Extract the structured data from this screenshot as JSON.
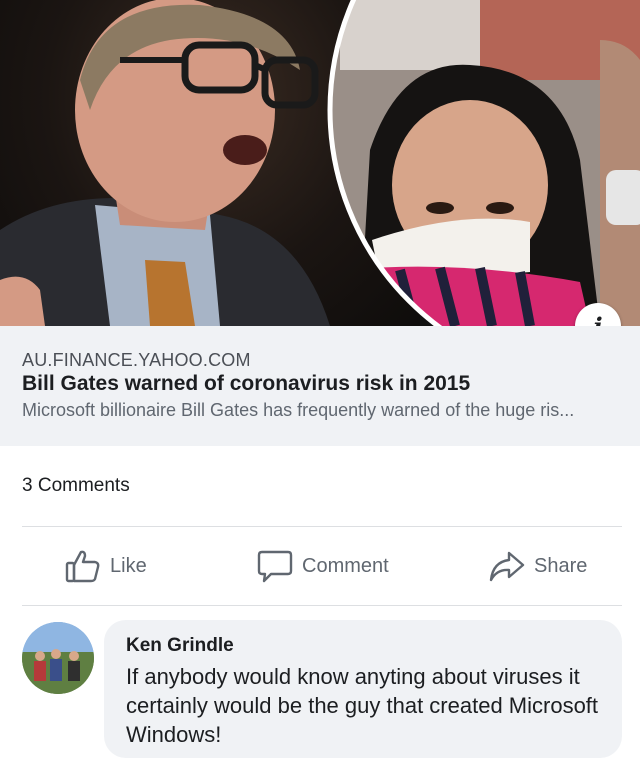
{
  "link_preview": {
    "domain": "AU.FINANCE.YAHOO.COM",
    "title": "Bill Gates warned of coronavirus risk in 2015",
    "description": "Microsoft billionaire Bill Gates has frequently warned of the huge ris..."
  },
  "info_icon_glyph": "i",
  "comments_count_label": "3 Comments",
  "actions": {
    "like_label": "Like",
    "comment_label": "Comment",
    "share_label": "Share"
  },
  "comment": {
    "author": "Ken Grindle",
    "text": "If anybody would know anyting about viruses it certainly would be the guy that created Microsoft Windows!"
  },
  "colors": {
    "preview_bg": "#f0f2f5",
    "action_text": "#606770",
    "primary_text": "#1c1e21"
  }
}
